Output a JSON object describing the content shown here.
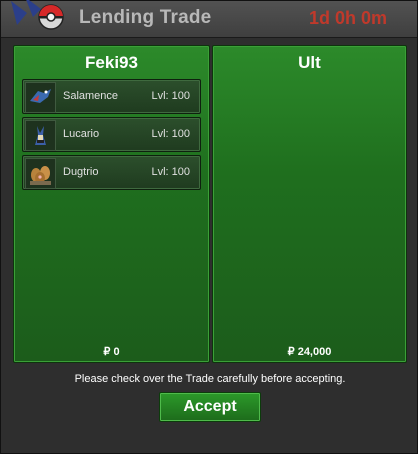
{
  "window": {
    "title": "Lending Trade",
    "timer": "1d 0h 0m"
  },
  "left": {
    "name": "Feki93",
    "items": [
      {
        "name": "Salamence",
        "level": "Lvl: 100",
        "icon": "salamence-icon"
      },
      {
        "name": "Lucario",
        "level": "Lvl: 100",
        "icon": "lucario-icon"
      },
      {
        "name": "Dugtrio",
        "level": "Lvl: 100",
        "icon": "dugtrio-icon"
      }
    ],
    "money": "₽ 0"
  },
  "right": {
    "name": "Ult",
    "money": "₽ 24,000"
  },
  "notice": "Please check over the Trade carefully before accepting.",
  "accept_label": "Accept",
  "colors": {
    "panel_green": "#2c8a2a",
    "timer_red": "#c0392b",
    "accent": "#1d6b1b"
  }
}
